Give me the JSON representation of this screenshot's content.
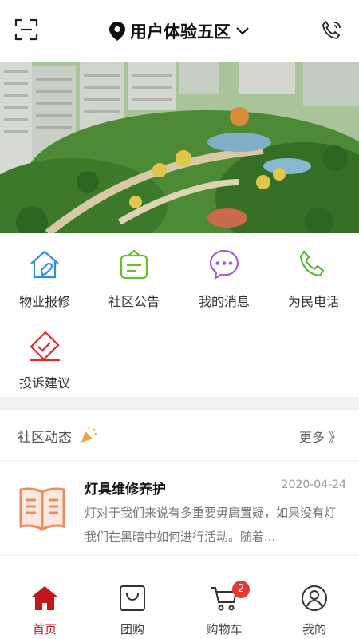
{
  "header": {
    "location_title": "用户体验五区",
    "icons": {
      "scan": "scan-icon",
      "location": "location-pin-icon",
      "dropdown": "chevron-down-icon",
      "phone": "phone-icon"
    }
  },
  "banner": {
    "image": "residential-community-photo"
  },
  "quick_actions": [
    {
      "label": "物业报修",
      "icon": "repair-house-icon",
      "color": "#2a8ef0"
    },
    {
      "label": "社区公告",
      "icon": "notice-board-icon",
      "color": "#6cbd2c"
    },
    {
      "label": "我的消息",
      "icon": "message-bubble-icon",
      "color": "#a45ad8"
    },
    {
      "label": "为民电话",
      "icon": "phone-icon",
      "color": "#5cb536"
    },
    {
      "label": "投诉建议",
      "icon": "complaint-icon",
      "color": "#e02b2b"
    }
  ],
  "news": {
    "section_title": "社区动态",
    "more_label": "更多 》",
    "items": [
      {
        "title": "灯具维修养护",
        "date": "2020-04-24",
        "desc": "灯对于我们来说有多重要毋庸置疑，如果没有灯我们在黑暗中如何进行活动。随着..."
      }
    ]
  },
  "tabbar": {
    "tabs": [
      {
        "label": "首页",
        "icon": "home-icon",
        "active": true
      },
      {
        "label": "团购",
        "icon": "shopping-bag-icon"
      },
      {
        "label": "购物车",
        "icon": "cart-icon",
        "badge": "2"
      },
      {
        "label": "我的",
        "icon": "user-icon"
      }
    ]
  },
  "colors": {
    "accent": "#c3161c",
    "badge": "#e53935"
  }
}
